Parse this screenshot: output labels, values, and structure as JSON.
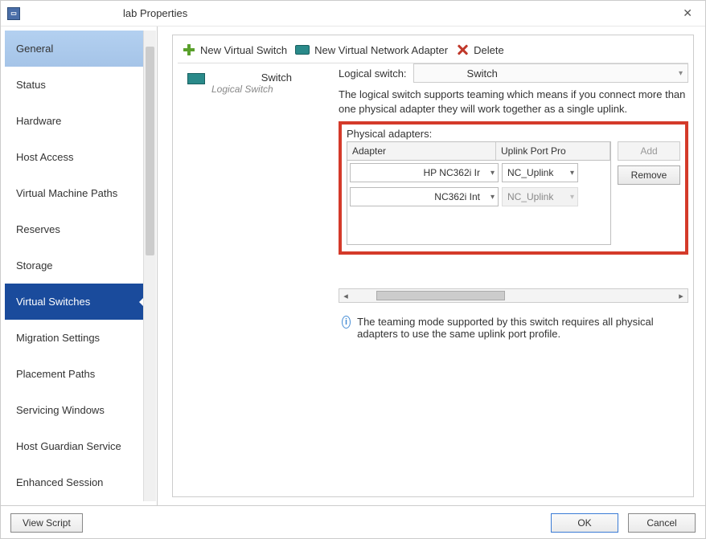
{
  "window": {
    "title": "lab Properties",
    "close_label": "✕"
  },
  "sidebar": {
    "items": [
      {
        "label": "General"
      },
      {
        "label": "Status"
      },
      {
        "label": "Hardware"
      },
      {
        "label": "Host Access"
      },
      {
        "label": "Virtual Machine Paths"
      },
      {
        "label": "Reserves"
      },
      {
        "label": "Storage"
      },
      {
        "label": "Virtual Switches"
      },
      {
        "label": "Migration Settings"
      },
      {
        "label": "Placement Paths"
      },
      {
        "label": "Servicing Windows"
      },
      {
        "label": "Host Guardian Service"
      },
      {
        "label": "Enhanced Session"
      }
    ]
  },
  "toolbar": {
    "new_switch": "New Virtual Switch",
    "new_adapter": "New Virtual Network Adapter",
    "delete": "Delete"
  },
  "switch_list": {
    "item_name": "Switch",
    "item_sub": "Logical Switch"
  },
  "logical_switch": {
    "label": "Logical switch:",
    "value": "Switch",
    "description": "The logical switch supports teaming which means if you connect more than one physical adapter they will work together as a single uplink."
  },
  "adapters": {
    "group_label": "Physical adapters:",
    "col_adapter": "Adapter",
    "col_uplink": "Uplink Port Pro",
    "add_label": "Add",
    "remove_label": "Remove",
    "rows": [
      {
        "adapter": "HP NC362i Ir",
        "uplink": "NC_Uplink",
        "uplink_disabled": false
      },
      {
        "adapter": "NC362i Int",
        "uplink": "NC_Uplink",
        "uplink_disabled": true
      }
    ]
  },
  "info_text": "The teaming mode supported by this switch requires all physical adapters to use the same uplink port profile.",
  "footer": {
    "view_script": "View Script",
    "ok": "OK",
    "cancel": "Cancel"
  }
}
